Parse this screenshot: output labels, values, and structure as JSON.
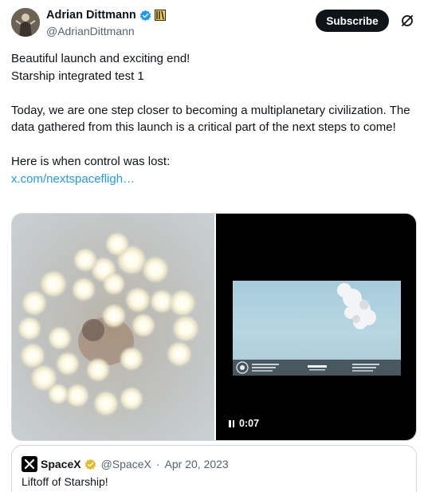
{
  "author": {
    "display_name": "Adrian Dittmann",
    "handle": "@AdrianDittmann",
    "avatar_icon": "profile-photo",
    "verified_color": "#1d9bf0"
  },
  "actions": {
    "subscribe_label": "Subscribe",
    "grok_icon": "grok-icon"
  },
  "tweet": {
    "lines": [
      "Beautiful launch and exciting end!",
      "Starship integrated test 1",
      "Today, we are one step closer to becoming a multiplanetary civilization. The data gathered from this launch is a critical part of the next steps to come!",
      "Here is when control was lost:"
    ],
    "link_text": "x.com/nextspacefligh…",
    "link_color": "#1d9bf0"
  },
  "media": {
    "left_image": "engine-cluster-photo",
    "video_time": "0:07",
    "video_clock": "T+00:04:01"
  },
  "quote": {
    "name": "SpaceX",
    "handle": "@SpaceX",
    "separator": "·",
    "date": "Apr 20, 2023",
    "text": "Liftoff of Starship!",
    "verified_color": "#e8b829"
  }
}
